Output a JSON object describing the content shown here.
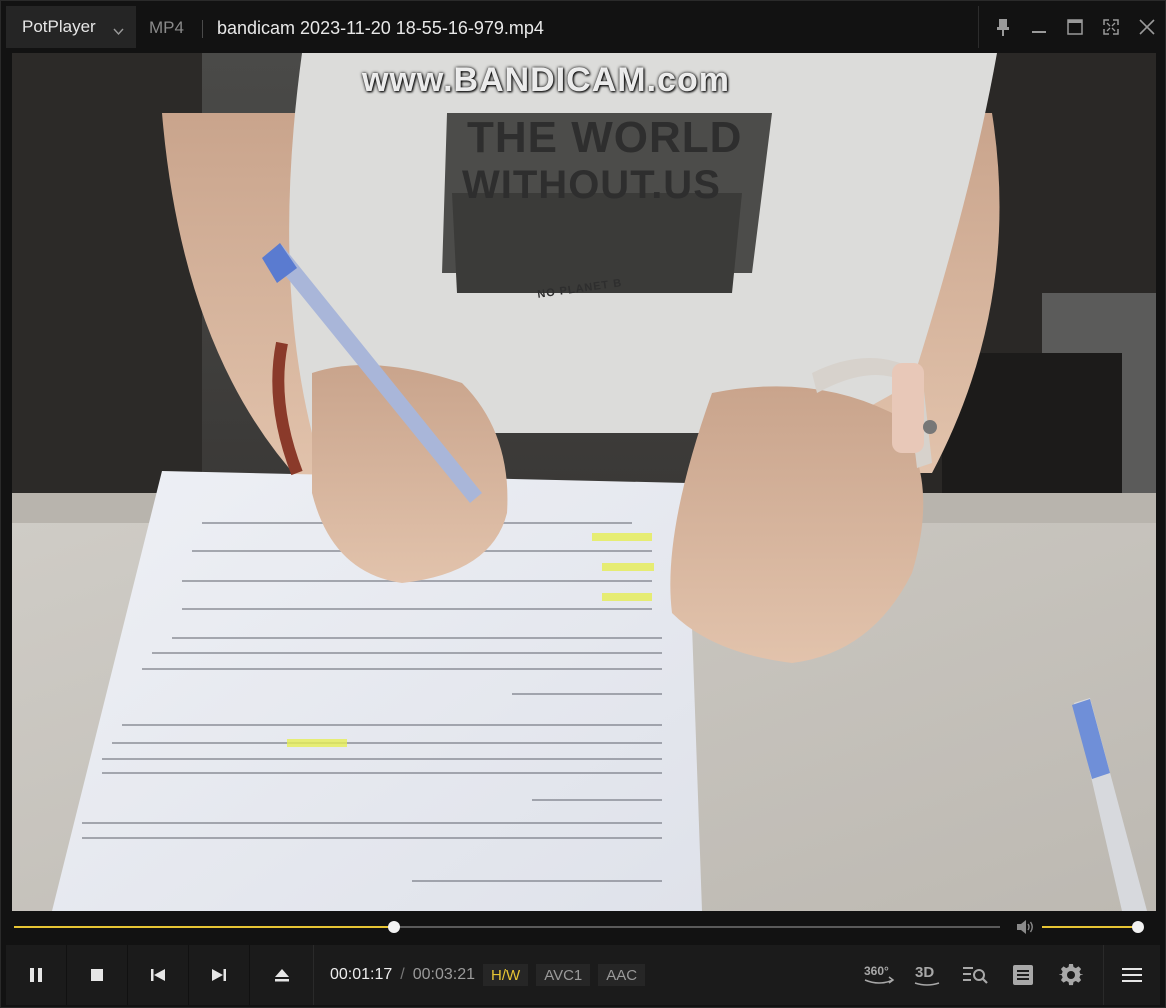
{
  "app": {
    "name": "PotPlayer",
    "format": "MP4",
    "file_title": "bandicam 2023-11-20 18-55-16-979.mp4"
  },
  "window_buttons": {
    "icons": [
      "pin-icon",
      "minimize-icon",
      "maximize-icon",
      "fullscreen-icon",
      "close-icon"
    ]
  },
  "video": {
    "watermark": "www.BANDICAM.com",
    "shirt_line1": "THE WORLD",
    "shirt_line2": "WITHOUT.US",
    "shirt_line3": "NO PLANET B"
  },
  "playback": {
    "progress": 0.385,
    "volume": 1.0,
    "current_time": "00:01:17",
    "separator": "/",
    "total_time": "00:03:21"
  },
  "badges": {
    "hw": "H/W",
    "video_codec": "AVC1",
    "audio_codec": "AAC"
  },
  "right_controls": {
    "vr_label": "360°",
    "stereo_label": "3D"
  },
  "colors": {
    "accent": "#e7c534",
    "background": "#121212",
    "controlbar": "#1b1b1b"
  }
}
